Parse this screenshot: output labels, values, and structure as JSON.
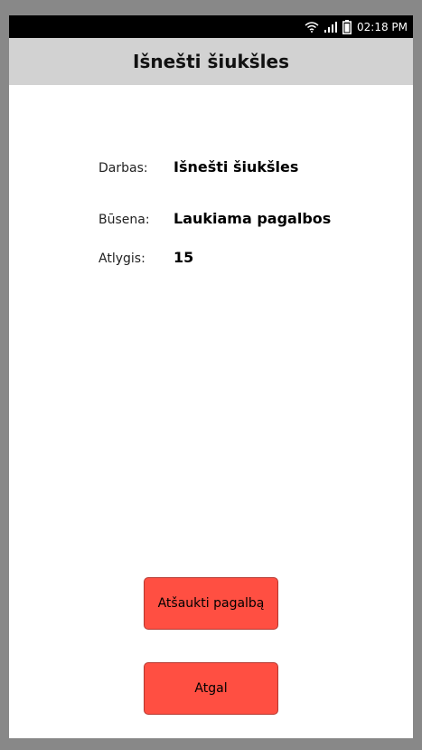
{
  "status_bar": {
    "time": "02:18 PM",
    "icons": [
      "wifi-icon",
      "signal-icon",
      "battery-icon"
    ]
  },
  "header": {
    "title": "Išnešti šiukšles"
  },
  "details": {
    "job_label": "Darbas:",
    "job_value": "Išnešti šiukšles",
    "status_label": "Būsena:",
    "status_value": "Laukiama pagalbos",
    "reward_label": "Atlygis:",
    "reward_value": "15"
  },
  "actions": {
    "cancel_help_label": "Atšaukti pagalbą",
    "back_label": "Atgal"
  },
  "colors": {
    "button_bg": "#ff4f42",
    "header_bg": "#d2d2d2",
    "status_bar_bg": "#000000"
  }
}
